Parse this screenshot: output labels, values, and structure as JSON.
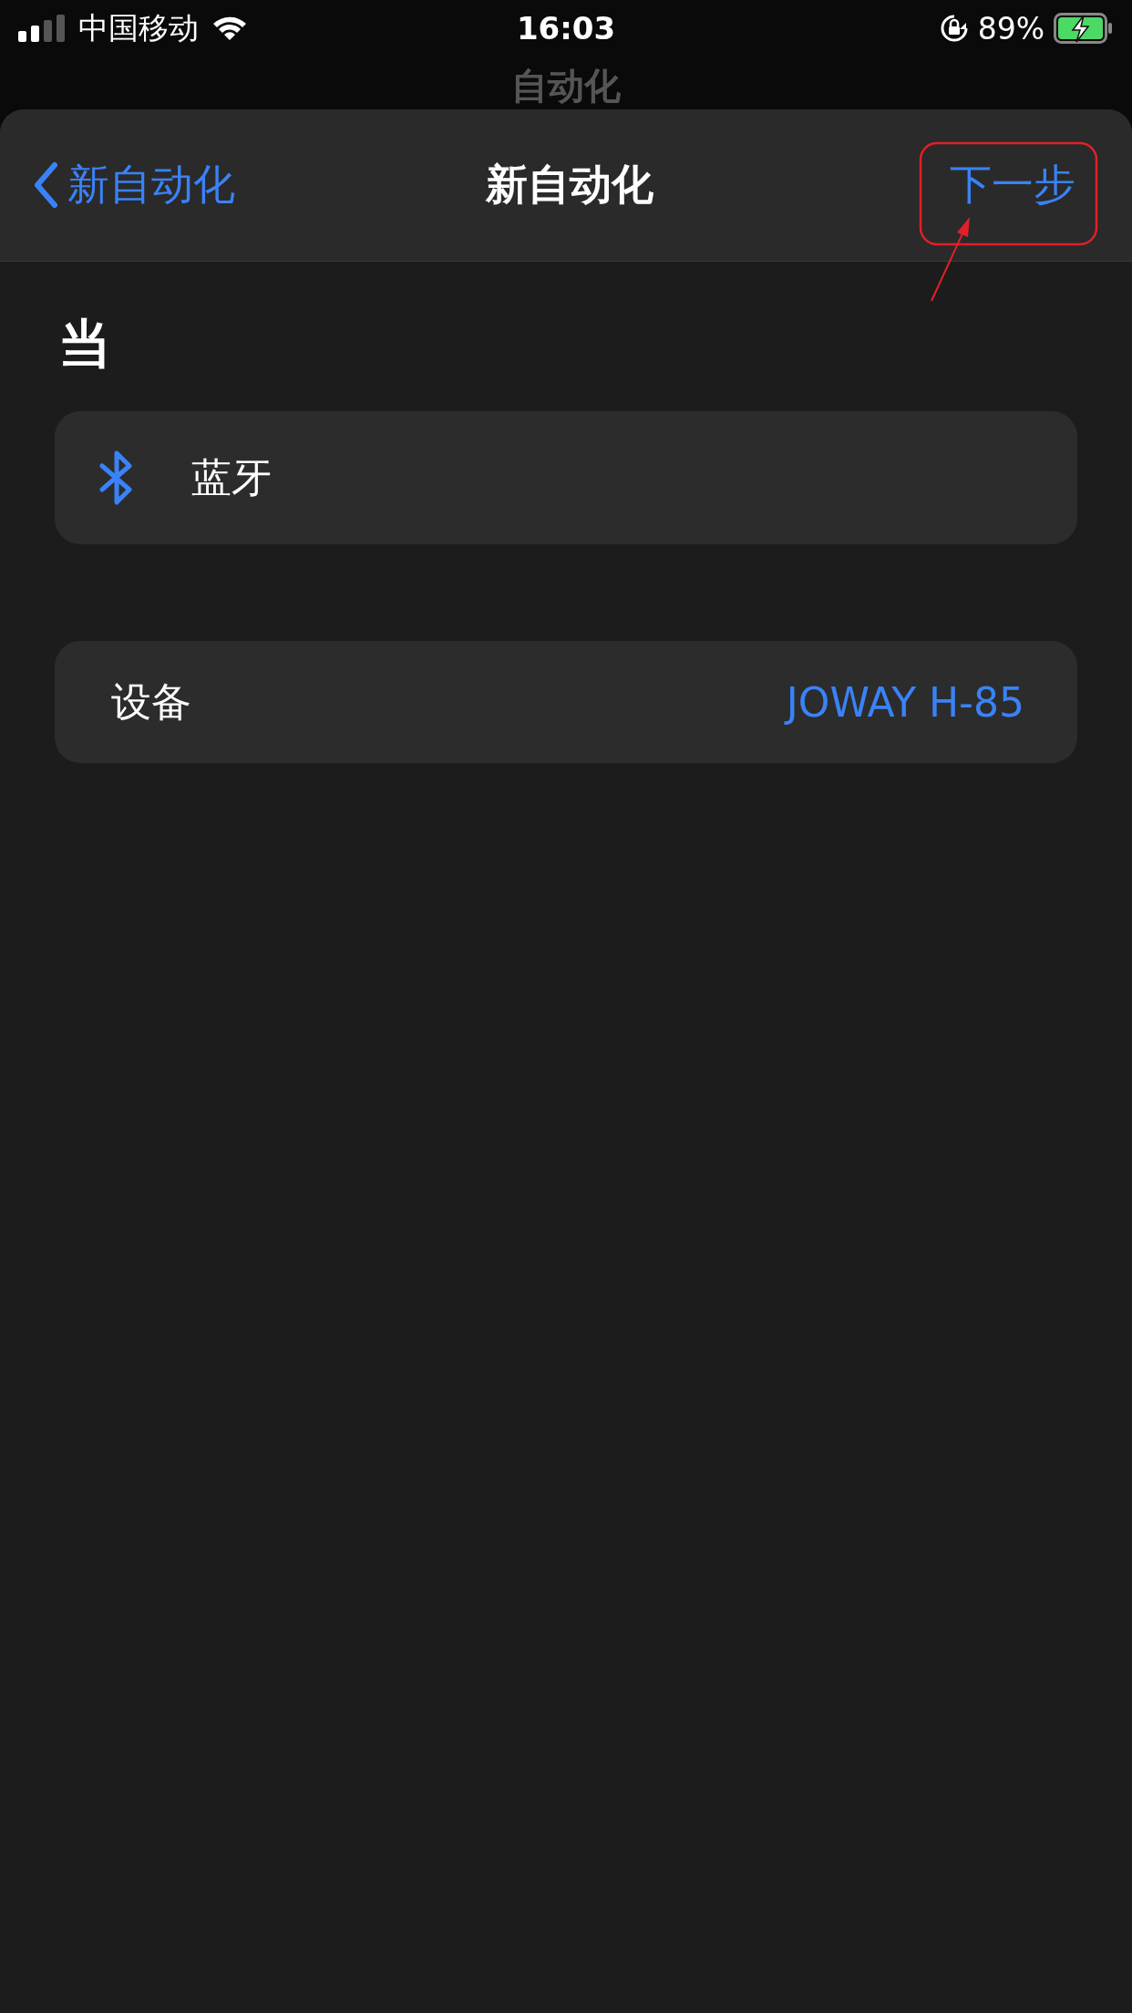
{
  "status_bar": {
    "carrier": "中国移动",
    "time": "16:03",
    "battery": "89%"
  },
  "background_title": "自动化",
  "nav": {
    "back": "新自动化",
    "title": "新自动化",
    "next": "下一步"
  },
  "section_header": "当",
  "trigger": {
    "label": "蓝牙"
  },
  "device": {
    "label": "设备",
    "value": "JOWAY H-85"
  },
  "annotation": {
    "kind": "highlight"
  }
}
